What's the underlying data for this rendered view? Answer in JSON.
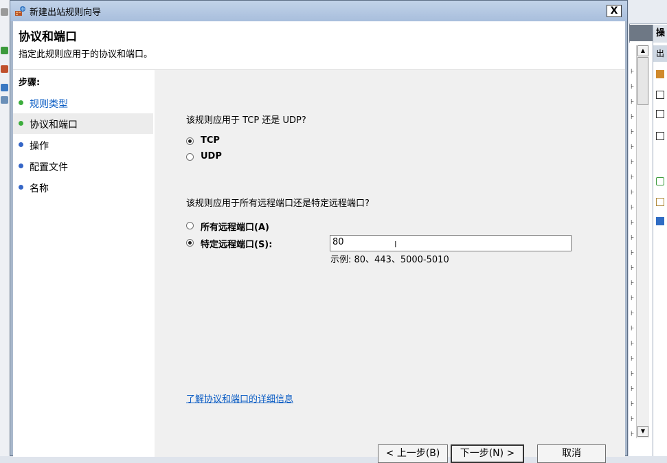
{
  "dialog": {
    "title": "新建出站规则向导",
    "close_label": "X"
  },
  "header": {
    "title": "协议和端口",
    "description": "指定此规则应用于的协议和端口。"
  },
  "steps": {
    "title": "步骤:",
    "items": [
      {
        "label": "规则类型",
        "state": "done"
      },
      {
        "label": "协议和端口",
        "state": "current"
      },
      {
        "label": "操作",
        "state": "todo"
      },
      {
        "label": "配置文件",
        "state": "todo"
      },
      {
        "label": "名称",
        "state": "todo"
      }
    ]
  },
  "protocol": {
    "question": "该规则应用于 TCP 还是 UDP?",
    "options": [
      {
        "label": "TCP",
        "selected": true
      },
      {
        "label": "UDP",
        "selected": false
      }
    ]
  },
  "ports": {
    "question": "该规则应用于所有远程端口还是特定远程端口?",
    "options": [
      {
        "label": "所有远程端口(A)",
        "selected": false
      },
      {
        "label": "特定远程端口(S):",
        "selected": true
      }
    ],
    "value": "80",
    "example": "示例: 80、443、5000-5010"
  },
  "link": {
    "label": "了解协议和端口的详细信息"
  },
  "buttons": {
    "back": "< 上一步(B)",
    "next": "下一步(N) >",
    "cancel": "取消"
  },
  "background": {
    "actions_header": "操",
    "actions_sub": "出"
  },
  "colors": {
    "step_done": "#3cad3c",
    "step_todo": "#3566c7",
    "link": "#0a5cc4",
    "title_bar": "#b3c7e2"
  }
}
